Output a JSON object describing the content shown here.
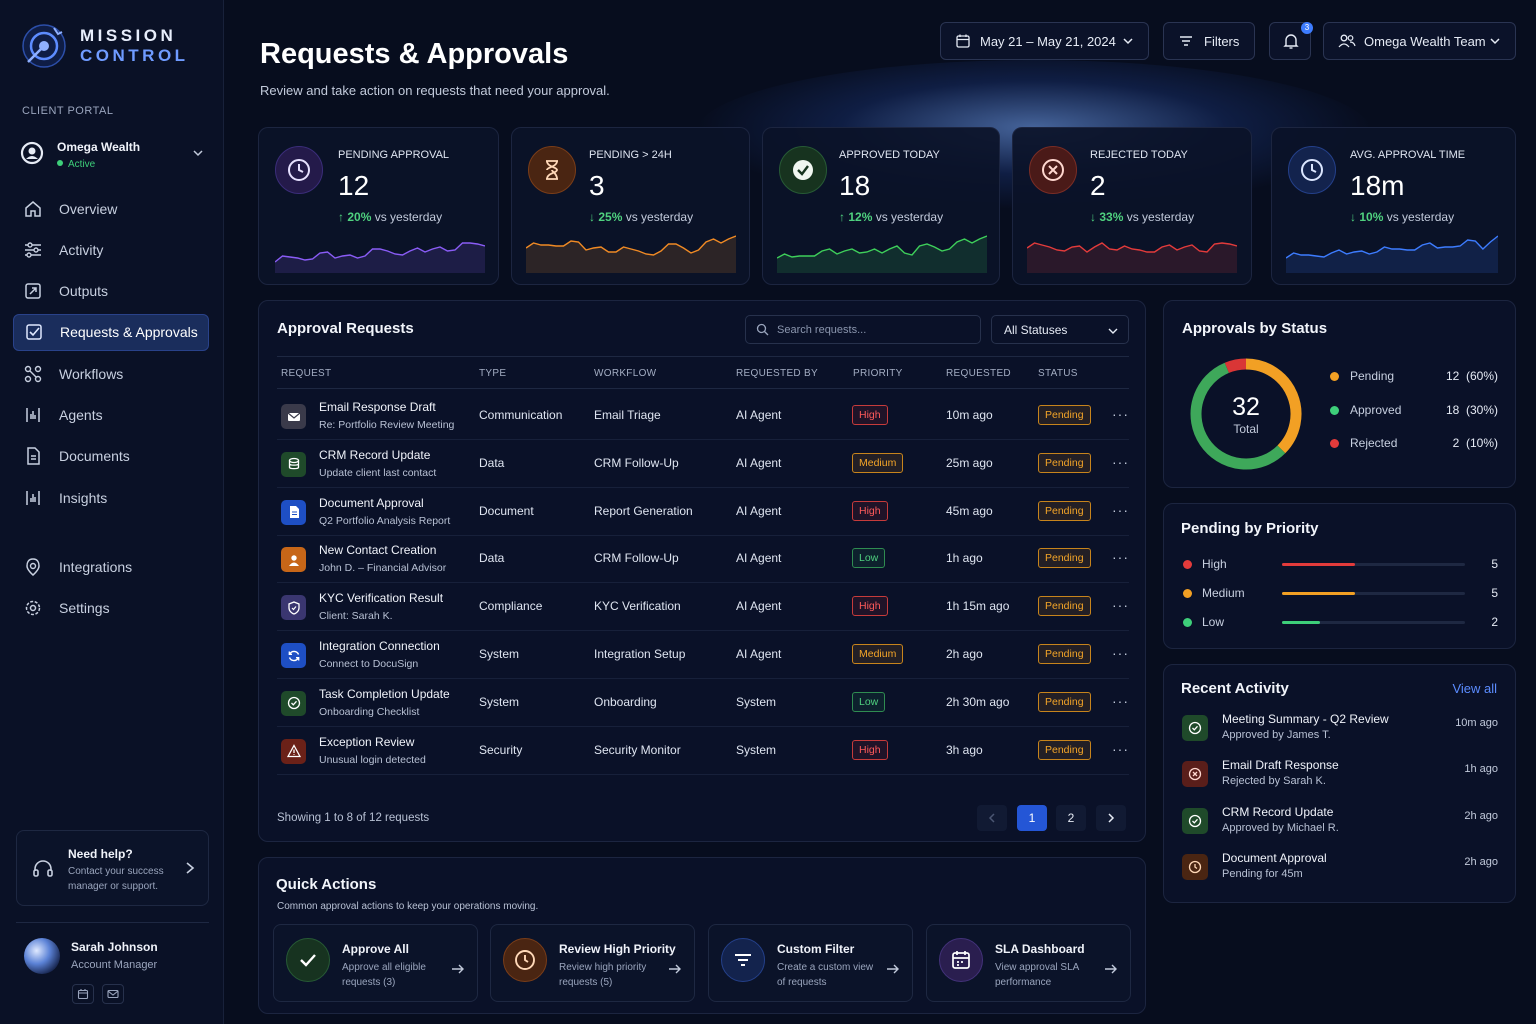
{
  "app": {
    "brand_line1": "MISSION",
    "brand_line2": "CONTROL"
  },
  "sidebar": {
    "section_label": "CLIENT PORTAL",
    "client": {
      "name": "Omega Wealth",
      "status": "Active"
    },
    "items": [
      {
        "label": "Overview",
        "icon": "home-icon"
      },
      {
        "label": "Activity",
        "icon": "sliders-icon"
      },
      {
        "label": "Outputs",
        "icon": "output-icon"
      },
      {
        "label": "Requests & Approvals",
        "icon": "checklist-icon",
        "active": true
      },
      {
        "label": "Workflows",
        "icon": "workflow-icon"
      },
      {
        "label": "Agents",
        "icon": "agent-icon"
      },
      {
        "label": "Documents",
        "icon": "document-icon"
      },
      {
        "label": "Insights",
        "icon": "insights-icon"
      },
      {
        "label": "Integrations",
        "icon": "integrations-icon"
      },
      {
        "label": "Settings",
        "icon": "gear-icon"
      }
    ],
    "help": {
      "title": "Need help?",
      "text": "Contact your success manager or support."
    },
    "user": {
      "name": "Sarah Johnson",
      "role": "Account Manager"
    }
  },
  "header": {
    "title": "Requests & Approvals",
    "subtitle": "Review and take action on requests that need your approval.",
    "date_range": "May 21 – May 21, 2024",
    "filters_label": "Filters",
    "notification_count": "3",
    "team_label": "Omega Wealth Team"
  },
  "kpis": [
    {
      "label": "PENDING APPROVAL",
      "value": "12",
      "change": "20%",
      "direction": "up",
      "suffix": "vs yesterday",
      "color": "#8a5cf6",
      "spark": [
        30,
        22,
        28,
        18,
        26,
        20,
        24,
        14,
        22,
        16,
        20,
        12,
        18,
        8,
        14
      ]
    },
    {
      "label": "PENDING > 24H",
      "value": "3",
      "change": "25%",
      "direction": "down",
      "suffix": "vs yesterday",
      "color": "#f08a24",
      "spark": [
        16,
        10,
        14,
        6,
        18,
        12,
        20,
        14,
        22,
        16,
        12,
        18,
        10,
        8,
        4
      ]
    },
    {
      "label": "APPROVED TODAY",
      "value": "18",
      "change": "12%",
      "direction": "up",
      "suffix": "vs yesterday",
      "color": "#3ecf5a",
      "spark": [
        26,
        22,
        24,
        16,
        22,
        14,
        20,
        18,
        14,
        20,
        12,
        16,
        10,
        8,
        4
      ]
    },
    {
      "label": "REJECTED TODAY",
      "value": "2",
      "change": "33%",
      "direction": "down",
      "suffix": "vs yesterday",
      "color": "#e33b3b",
      "spark": [
        16,
        10,
        18,
        12,
        20,
        8,
        18,
        14,
        20,
        12,
        18,
        10,
        20,
        8,
        14
      ]
    },
    {
      "label": "AVG. APPROVAL TIME",
      "value": "18m",
      "change": "10%",
      "direction": "down",
      "suffix": "vs yesterday",
      "color": "#3d7cff",
      "spark": [
        26,
        20,
        24,
        18,
        22,
        16,
        20,
        14,
        18,
        10,
        16,
        12,
        8,
        14,
        4
      ]
    }
  ],
  "requests": {
    "title": "Approval Requests",
    "search_placeholder": "Search requests...",
    "status_filter": "All Statuses",
    "columns": [
      "REQUEST",
      "TYPE",
      "WORKFLOW",
      "REQUESTED BY",
      "PRIORITY",
      "REQUESTED",
      "STATUS"
    ],
    "rows": [
      {
        "title": "Email Response Draft",
        "sub": "Re: Portfolio Review Meeting",
        "type": "Communication",
        "workflow": "Email Triage",
        "by": "AI Agent",
        "priority": "High",
        "requested": "10m ago",
        "status": "Pending",
        "icon": "mail-icon"
      },
      {
        "title": "CRM Record Update",
        "sub": "Update client last contact",
        "type": "Data",
        "workflow": "CRM Follow-Up",
        "by": "AI Agent",
        "priority": "Medium",
        "requested": "25m ago",
        "status": "Pending",
        "icon": "database-icon"
      },
      {
        "title": "Document Approval",
        "sub": "Q2 Portfolio Analysis Report",
        "type": "Document",
        "workflow": "Report Generation",
        "by": "AI Agent",
        "priority": "High",
        "requested": "45m ago",
        "status": "Pending",
        "icon": "document-icon"
      },
      {
        "title": "New Contact Creation",
        "sub": "John D. – Financial Advisor",
        "type": "Data",
        "workflow": "CRM Follow-Up",
        "by": "AI Agent",
        "priority": "Low",
        "requested": "1h ago",
        "status": "Pending",
        "icon": "person-icon"
      },
      {
        "title": "KYC Verification Result",
        "sub": "Client: Sarah K.",
        "type": "Compliance",
        "workflow": "KYC Verification",
        "by": "AI Agent",
        "priority": "High",
        "requested": "1h 15m ago",
        "status": "Pending",
        "icon": "shield-icon"
      },
      {
        "title": "Integration Connection",
        "sub": "Connect to DocuSign",
        "type": "System",
        "workflow": "Integration Setup",
        "by": "AI Agent",
        "priority": "Medium",
        "requested": "2h ago",
        "status": "Pending",
        "icon": "sync-icon"
      },
      {
        "title": "Task Completion Update",
        "sub": "Onboarding Checklist",
        "type": "System",
        "workflow": "Onboarding",
        "by": "System",
        "priority": "Low",
        "requested": "2h 30m ago",
        "status": "Pending",
        "icon": "check-circle-icon"
      },
      {
        "title": "Exception Review",
        "sub": "Unusual login detected",
        "type": "Security",
        "workflow": "Security Monitor",
        "by": "System",
        "priority": "High",
        "requested": "3h ago",
        "status": "Pending",
        "icon": "warning-icon"
      }
    ],
    "showing": "Showing 1 to 8 of 12 requests",
    "pages": [
      "1",
      "2"
    ]
  },
  "approvals_by_status": {
    "title": "Approvals by Status",
    "total": "32",
    "total_label": "Total",
    "items": [
      {
        "name": "Pending",
        "count": "12",
        "pct": "(60%)",
        "color": "#f2a024",
        "value": 12
      },
      {
        "name": "Approved",
        "count": "18",
        "pct": "(30%)",
        "color": "#3ea85a",
        "value": 18
      },
      {
        "name": "Rejected",
        "count": "2",
        "pct": "(10%)",
        "color": "#d93636",
        "value": 2
      }
    ]
  },
  "pending_by_priority": {
    "title": "Pending by Priority",
    "items": [
      {
        "name": "High",
        "count": "5",
        "color": "#e33b3b",
        "fraction": 0.4
      },
      {
        "name": "Medium",
        "count": "5",
        "color": "#f2a024",
        "fraction": 0.4
      },
      {
        "name": "Low",
        "count": "2",
        "color": "#3ecf7a",
        "fraction": 0.21
      }
    ]
  },
  "recent_activity": {
    "title": "Recent Activity",
    "view_all": "View all",
    "items": [
      {
        "title": "Meeting Summary - Q2 Review",
        "sub": "Approved by James T.",
        "time": "10m ago",
        "kind": "approved"
      },
      {
        "title": "Email Draft Response",
        "sub": "Rejected by Sarah K.",
        "time": "1h ago",
        "kind": "rejected"
      },
      {
        "title": "CRM Record Update",
        "sub": "Approved by Michael R.",
        "time": "2h ago",
        "kind": "approved"
      },
      {
        "title": "Document Approval",
        "sub": "Pending for 45m",
        "time": "2h ago",
        "kind": "pending"
      }
    ]
  },
  "quick_actions": {
    "title": "Quick Actions",
    "subtitle": "Common approval actions to keep your operations moving.",
    "items": [
      {
        "title": "Approve All",
        "desc": "Approve all eligible requests (3)",
        "icon": "check-icon"
      },
      {
        "title": "Review High Priority",
        "desc": "Review high priority requests (5)",
        "icon": "clock-icon"
      },
      {
        "title": "Custom Filter",
        "desc": "Create a custom view of requests",
        "icon": "filter-icon"
      },
      {
        "title": "SLA Dashboard",
        "desc": "View approval SLA performance",
        "icon": "calendar-icon"
      }
    ]
  }
}
